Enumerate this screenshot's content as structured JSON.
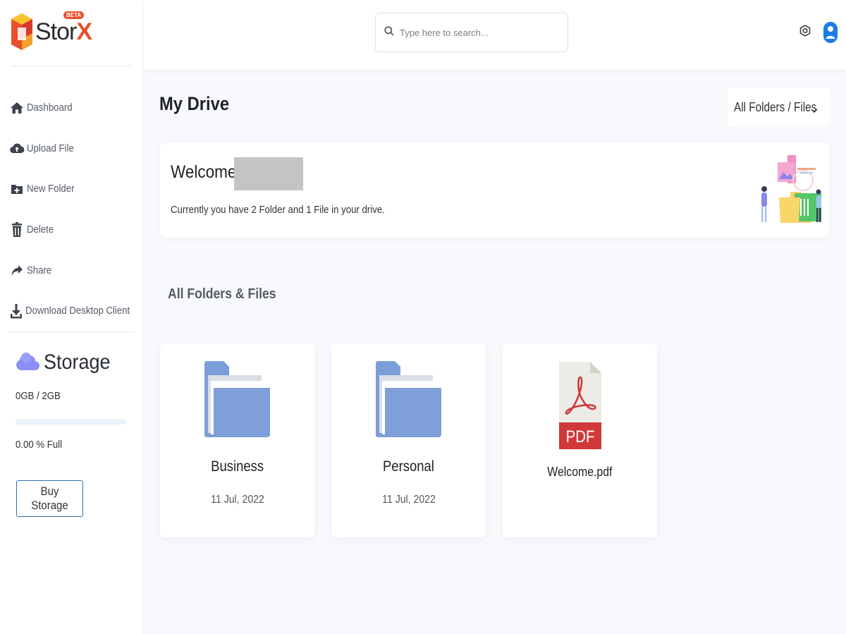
{
  "brand": {
    "name_prefix": "Stor",
    "name_suffix": "X",
    "badge": "BETA"
  },
  "sidebar": {
    "items": [
      {
        "label": "Dashboard",
        "icon": "home-icon"
      },
      {
        "label": "Upload File",
        "icon": "cloud-upload-icon"
      },
      {
        "label": "New Folder",
        "icon": "folder-plus-icon"
      },
      {
        "label": "Delete",
        "icon": "trash-icon"
      },
      {
        "label": "Share",
        "icon": "share-icon"
      },
      {
        "label": "Download Desktop Client",
        "icon": "download-icon"
      }
    ],
    "storage": {
      "title": "Storage",
      "used": "0GB / 2GB",
      "percent_text": "0.00 % Full",
      "fill_fraction": 0.0,
      "buy_label": "Buy Storage"
    }
  },
  "header": {
    "search_placeholder": "Type here to search...",
    "settings_icon": "gear-icon",
    "user_icon": "user-icon"
  },
  "main": {
    "title": "My Drive",
    "filter_label": "All Folders / Files",
    "welcome": {
      "title": "Welcome:",
      "text": "Currently you have 2 Folder and 1 File in your drive."
    },
    "section_title": "All Folders & Files",
    "items": [
      {
        "type": "folder",
        "name": "Business",
        "date": "11 Jul, 2022"
      },
      {
        "type": "folder",
        "name": "Personal",
        "date": "11 Jul, 2022"
      },
      {
        "type": "file",
        "name": "Welcome.pdf",
        "badge": "PDF"
      }
    ]
  },
  "colors": {
    "accent": "#2f6fb0",
    "folder": "#7b9ed8",
    "pdf_red": "#d0383a",
    "user": "#1a7de8",
    "brand_orange": "#e8502b"
  }
}
